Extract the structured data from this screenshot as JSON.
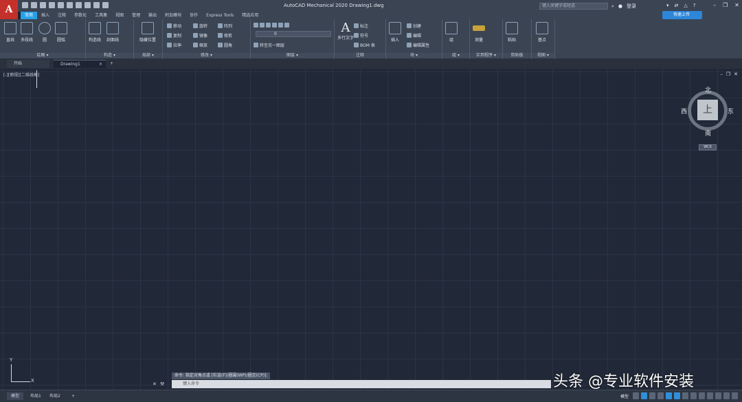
{
  "window": {
    "title": "AutoCAD Mechanical 2020    Drawing1.dwg",
    "logo_text": "A",
    "search_placeholder": "键入关键字或短语",
    "login_label": "登录",
    "upload_label": "快速上传"
  },
  "menu_tabs": [
    {
      "label": "常用",
      "active": true
    },
    {
      "label": "插入"
    },
    {
      "label": "注释"
    },
    {
      "label": "参数化"
    },
    {
      "label": "工具集"
    },
    {
      "label": "视图"
    },
    {
      "label": "管理"
    },
    {
      "label": "输出"
    },
    {
      "label": "附加模块"
    },
    {
      "label": "协作"
    },
    {
      "label": "Express Tools"
    },
    {
      "label": "精选应用"
    }
  ],
  "ribbon": {
    "draw": {
      "label": "绘图 ▾",
      "line": "直线",
      "polyline": "多段线",
      "circle": "圆",
      "arc": "圆弧"
    },
    "construct": {
      "label": "构造 ▾",
      "line_mode": "构造线",
      "model": "剖面线"
    },
    "detail": {
      "label": "局部 ▾",
      "move": "移动",
      "copy": "复制",
      "stretch": "拉伸",
      "rotate": "旋转",
      "mirror": "镜像",
      "scale": "缩放",
      "array": "阵列",
      "fillet": "圆角",
      "trim": "修剪",
      "modify_label": "修改 ▾",
      "position": "隐藏位置"
    },
    "layer": {
      "label": "图层 ▾",
      "current": "0",
      "match": "转至另一图层"
    },
    "annotation": {
      "label": "注释",
      "mtext": "多行文字",
      "dim": "标注",
      "symbol": "符号",
      "bom": "BOM 表"
    },
    "block": {
      "label": "块 ▾",
      "insert": "插入",
      "create": "创建",
      "edit": "编辑",
      "edit_attr": "编辑属性"
    },
    "group": {
      "label": "组 ▾",
      "group": "组"
    },
    "utilities": {
      "label": "实用程序 ▾",
      "measure": "测量"
    },
    "clipboard": {
      "label": "剪贴板",
      "paste": "粘贴"
    },
    "view": {
      "label": "视图 ▾",
      "base": "基点"
    }
  },
  "doc_tabs": {
    "start": "开始",
    "drawing": "Drawing1",
    "close": "×",
    "add": "+"
  },
  "canvas": {
    "viewport_label": "[-][俯视][二维线框]"
  },
  "viewcube": {
    "north": "北",
    "south": "南",
    "west": "西",
    "east": "东",
    "top": "上",
    "wcs": "WCS"
  },
  "ucs": {
    "x": "X",
    "y": "Y"
  },
  "command": {
    "history": "命令: 指定对角点或 [栏选(F)/圈围(WP)/圈交(CP)]:",
    "placeholder": "键入命令"
  },
  "watermark": "头条 @专业软件安装",
  "status": {
    "tabs": [
      "模型",
      "布局1",
      "布局2",
      "+"
    ],
    "model_label": "模型"
  }
}
